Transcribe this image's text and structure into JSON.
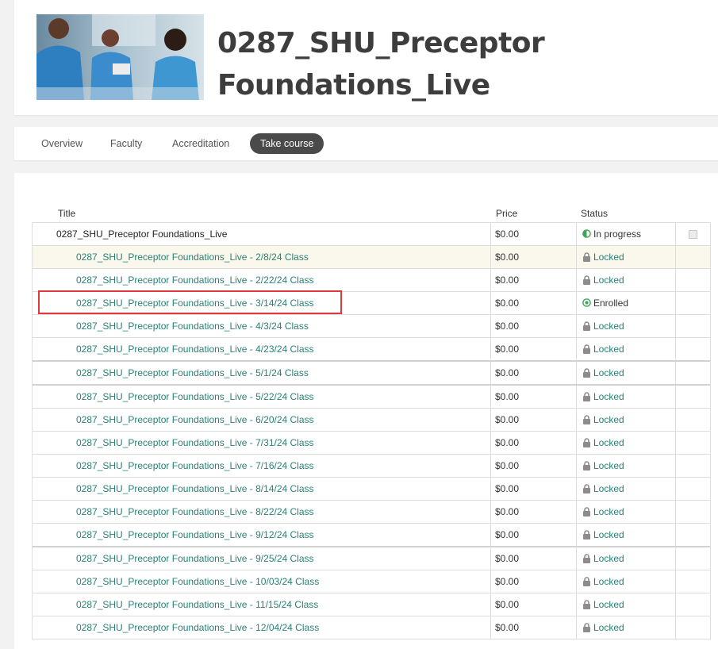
{
  "course": {
    "title_line1": "0287_SHU_Preceptor",
    "title_line2": "Foundations_Live"
  },
  "tabs": [
    {
      "label": "Overview"
    },
    {
      "label": "Faculty"
    },
    {
      "label": "Accreditation"
    },
    {
      "label": "Take course",
      "active": true
    }
  ],
  "table": {
    "headers": {
      "title": "Title",
      "price": "Price",
      "status": "Status"
    },
    "rows": [
      {
        "title": "0287_SHU_Preceptor Foundations_Live",
        "price": "$0.00",
        "status": "In progress"
      },
      {
        "title": "0287_SHU_Preceptor Foundations_Live - 2/8/24 Class",
        "price": "$0.00",
        "status": "Locked"
      },
      {
        "title": "0287_SHU_Preceptor Foundations_Live - 2/22/24 Class",
        "price": "$0.00",
        "status": "Locked"
      },
      {
        "title": "0287_SHU_Preceptor Foundations_Live - 3/14/24 Class",
        "price": "$0.00",
        "status": "Enrolled"
      },
      {
        "title": "0287_SHU_Preceptor Foundations_Live - 4/3/24 Class",
        "price": "$0.00",
        "status": "Locked"
      },
      {
        "title": "0287_SHU_Preceptor Foundations_Live - 4/23/24 Class",
        "price": "$0.00",
        "status": "Locked"
      },
      {
        "title": "0287_SHU_Preceptor Foundations_Live - 5/1/24 Class",
        "price": "$0.00",
        "status": "Locked"
      },
      {
        "title": "0287_SHU_Preceptor Foundations_Live - 5/22/24 Class",
        "price": "$0.00",
        "status": "Locked"
      },
      {
        "title": "0287_SHU_Preceptor Foundations_Live - 6/20/24 Class",
        "price": "$0.00",
        "status": "Locked"
      },
      {
        "title": "0287_SHU_Preceptor Foundations_Live - 7/31/24 Class",
        "price": "$0.00",
        "status": "Locked"
      },
      {
        "title": "0287_SHU_Preceptor Foundations_Live - 7/16/24 Class",
        "price": "$0.00",
        "status": "Locked"
      },
      {
        "title": "0287_SHU_Preceptor Foundations_Live - 8/14/24 Class",
        "price": "$0.00",
        "status": "Locked"
      },
      {
        "title": "0287_SHU_Preceptor Foundations_Live - 8/22/24 Class",
        "price": "$0.00",
        "status": "Locked"
      },
      {
        "title": "0287_SHU_Preceptor Foundations_Live - 9/12/24 Class",
        "price": "$0.00",
        "status": "Locked"
      },
      {
        "title": "0287_SHU_Preceptor Foundations_Live - 9/25/24 Class",
        "price": "$0.00",
        "status": "Locked"
      },
      {
        "title": "0287_SHU_Preceptor Foundations_Live - 10/03/24 Class",
        "price": "$0.00",
        "status": "Locked"
      },
      {
        "title": "0287_SHU_Preceptor Foundations_Live - 11/15/24 Class",
        "price": "$0.00",
        "status": "Locked"
      },
      {
        "title": "0287_SHU_Preceptor Foundations_Live - 12/04/24 Class",
        "price": "$0.00",
        "status": "Locked"
      }
    ]
  },
  "colors": {
    "link_teal": "#2a8076",
    "active_tab": "#4a4a4a",
    "highlight_box": "#e0383a",
    "progress_green": "#3aa655",
    "locked_grey": "#8c8c8c"
  },
  "icons": {
    "locked": "lock-icon",
    "enrolled": "enrolled-circle-icon",
    "in_progress": "half-circle-progress-icon",
    "checkbox": "checkbox-icon"
  }
}
